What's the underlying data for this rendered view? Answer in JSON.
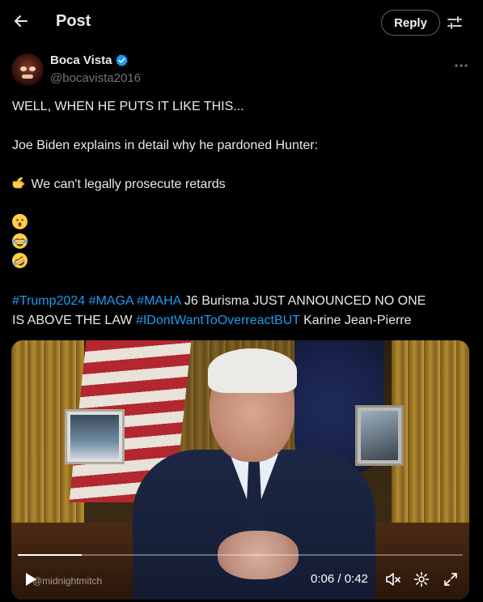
{
  "header": {
    "title": "Post",
    "reply_label": "Reply"
  },
  "author": {
    "name": "Boca Vista",
    "handle": "@bocavista2016",
    "verified": true
  },
  "post": {
    "lines": [
      "WELL, WHEN HE PUTS IT LIKE THIS...",
      "Joe Biden explains in detail why he pardoned Hunter:",
      "We can't legally prosecute retards"
    ],
    "emojis": [
      "hushed-face",
      "joy-face",
      "rofl-face"
    ],
    "tags_line1": [
      {
        "text": "#Trump2024",
        "type": "hashtag"
      },
      {
        "text": " ",
        "type": "text"
      },
      {
        "text": "#MAGA",
        "type": "hashtag"
      },
      {
        "text": " ",
        "type": "text"
      },
      {
        "text": "#MAHA",
        "type": "hashtag"
      },
      {
        "text": " J6 Burisma JUST ANNOUNCED NO ONE",
        "type": "text"
      }
    ],
    "tags_line2": [
      {
        "text": "IS ABOVE THE LAW ",
        "type": "text"
      },
      {
        "text": "#IDontWantToOverreactBUT",
        "type": "hashtag"
      },
      {
        "text": " Karine Jean-Pierre",
        "type": "text"
      }
    ]
  },
  "video": {
    "watermark": "@midnightmitch",
    "current_time": "0:06",
    "duration": "0:42",
    "time_display": "0:06 / 0:42",
    "progress_fraction": 0.143
  },
  "colors": {
    "background": "#000000",
    "text": "#e7e9ea",
    "muted": "#71767b",
    "link": "#1d9bf0",
    "verified": "#1d9bf0"
  },
  "icons": [
    "back-arrow-icon",
    "filter-icon",
    "verified-badge-icon",
    "more-icon",
    "pointing-hand-icon",
    "play-icon",
    "mute-icon",
    "settings-icon",
    "fullscreen-icon"
  ]
}
